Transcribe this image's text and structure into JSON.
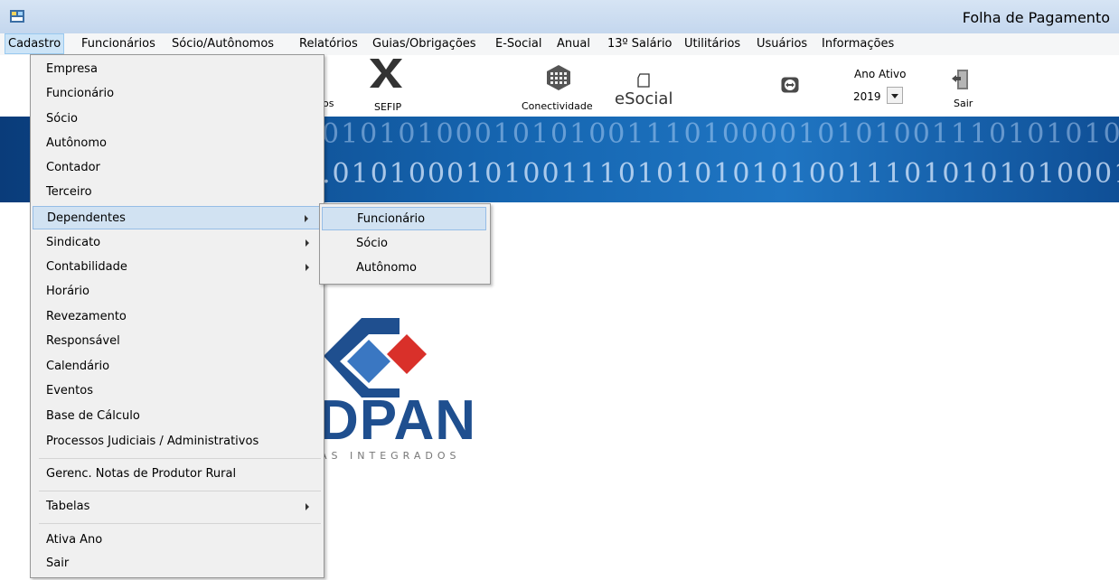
{
  "window": {
    "title": "Folha de Pagamento"
  },
  "menubar": {
    "items": [
      "Cadastro",
      "Funcionários",
      "Sócio/Autônomos",
      "Relatórios",
      "Guias/Obrigações",
      "E-Social",
      "Anual",
      "13º Salário",
      "Utilitários",
      "Usuários",
      "Informações"
    ]
  },
  "toolbar": {
    "partial_label": "os",
    "sefip": "SEFIP",
    "conectividade": "Conectividade",
    "esocial": "eSocial",
    "ano_ativo_label": "Ano Ativo",
    "ano_ativo_value": "2019",
    "sair": "Sair"
  },
  "banner": {
    "line1": "0101010001010100111010000101010011101010101",
    "line2": ".010100010100111010101010100111010101010001"
  },
  "logo": {
    "text": "DPAN",
    "subtitle": "AS INTEGRADOS"
  },
  "cadastro_menu": {
    "items": [
      "Empresa",
      "Funcionário",
      "Sócio",
      "Autônomo",
      "Contador",
      "Terceiro",
      "Dependentes",
      "Sindicato",
      "Contabilidade",
      "Horário",
      "Revezamento",
      "Responsável",
      "Calendário",
      "Eventos",
      "Base de Cálculo",
      "Processos Judiciais / Administrativos",
      "Gerenc. Notas de Produtor Rural",
      "Tabelas",
      "Ativa Ano",
      "Sair"
    ]
  },
  "dependentes_submenu": {
    "items": [
      "Funcionário",
      "Sócio",
      "Autônomo"
    ]
  },
  "colors": {
    "titlebar": "#c4d7ee",
    "menu_highlight": "#d1e2f2",
    "banner": "#1565b0",
    "logo_blue": "#1f4f8f",
    "logo_red": "#d9302a"
  }
}
